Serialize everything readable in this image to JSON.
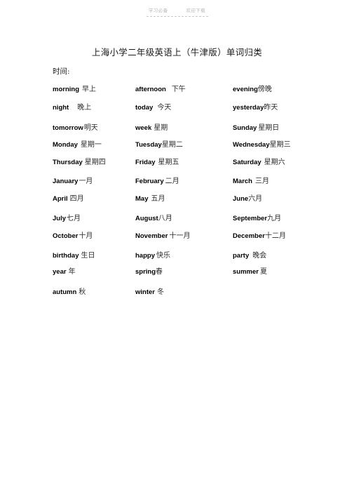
{
  "header": {
    "watermark_left": "学习必备",
    "watermark_right": "欢迎下载"
  },
  "document": {
    "title": "上海小学二年级英语上（牛津版）单词归类",
    "section_label": "时间:"
  },
  "vocabulary": {
    "rows": [
      [
        {
          "en": "morning",
          "gap": 4,
          "cn": "早上"
        },
        {
          "en": "afternoon",
          "gap": 8,
          "cn": "下午"
        },
        {
          "en": "evening",
          "gap": 0,
          "cn": "傍晚"
        }
      ],
      [
        {
          "en": "night",
          "gap": 12,
          "cn": "晚上"
        },
        {
          "en": "today",
          "gap": 6,
          "cn": "今天"
        },
        {
          "en": "yesterday",
          "gap": 0,
          "cn": "昨天"
        }
      ],
      [
        {
          "en": "tomorrow",
          "gap": 1,
          "cn": "明天"
        },
        {
          "en": "week",
          "gap": 3,
          "cn": "星期"
        },
        {
          "en": "Sunday",
          "gap": 2,
          "cn": "星期日"
        }
      ],
      [
        {
          "en": "Monday",
          "gap": 4,
          "cn": "星期一"
        },
        {
          "en": "Tuesday",
          "gap": 0,
          "cn": "星期二"
        },
        {
          "en": "Wednesday",
          "gap": 0,
          "cn": "星期三"
        }
      ],
      [
        {
          "en": "Thursday",
          "gap": 3,
          "cn": "星期四"
        },
        {
          "en": "Friday",
          "gap": 4,
          "cn": "星期五"
        },
        {
          "en": "Saturday",
          "gap": 4,
          "cn": "星期六"
        }
      ],
      [
        {
          "en": "January",
          "gap": 1,
          "cn": "一月"
        },
        {
          "en": "February",
          "gap": 2,
          "cn": "二月"
        },
        {
          "en": "March",
          "gap": 4,
          "cn": "三月"
        }
      ],
      [
        {
          "en": "April",
          "gap": 3,
          "cn": "四月"
        },
        {
          "en": "May",
          "gap": 4,
          "cn": "五月"
        },
        {
          "en": "June",
          "gap": 0,
          "cn": "六月"
        }
      ],
      [
        {
          "en": "July",
          "gap": 1,
          "cn": "七月"
        },
        {
          "en": "August",
          "gap": 0,
          "cn": "八月"
        },
        {
          "en": "September",
          "gap": 0,
          "cn": "九月"
        }
      ],
      [
        {
          "en": "October",
          "gap": 1,
          "cn": "十月"
        },
        {
          "en": "November",
          "gap": 2,
          "cn": "十一月"
        },
        {
          "en": "December",
          "gap": 0,
          "cn": "十二月"
        }
      ],
      [
        {
          "en": "birthday",
          "gap": 3,
          "cn": "生日"
        },
        {
          "en": "happy",
          "gap": 2,
          "cn": "快乐"
        },
        {
          "en": "party",
          "gap": 5,
          "cn": "晚会"
        }
      ],
      [
        {
          "en": "year",
          "gap": 3,
          "cn": "年"
        },
        {
          "en": "spring",
          "gap": 0,
          "cn": "春"
        },
        {
          "en": "summer",
          "gap": 2,
          "cn": "夏"
        }
      ],
      [
        {
          "en": "autumn",
          "gap": 3,
          "cn": "秋"
        },
        {
          "en": "winter",
          "gap": 3,
          "cn": "冬"
        }
      ]
    ],
    "row_offsets": [
      0,
      0,
      3,
      1,
      0,
      1,
      0,
      2,
      1,
      3,
      0,
      3
    ]
  }
}
